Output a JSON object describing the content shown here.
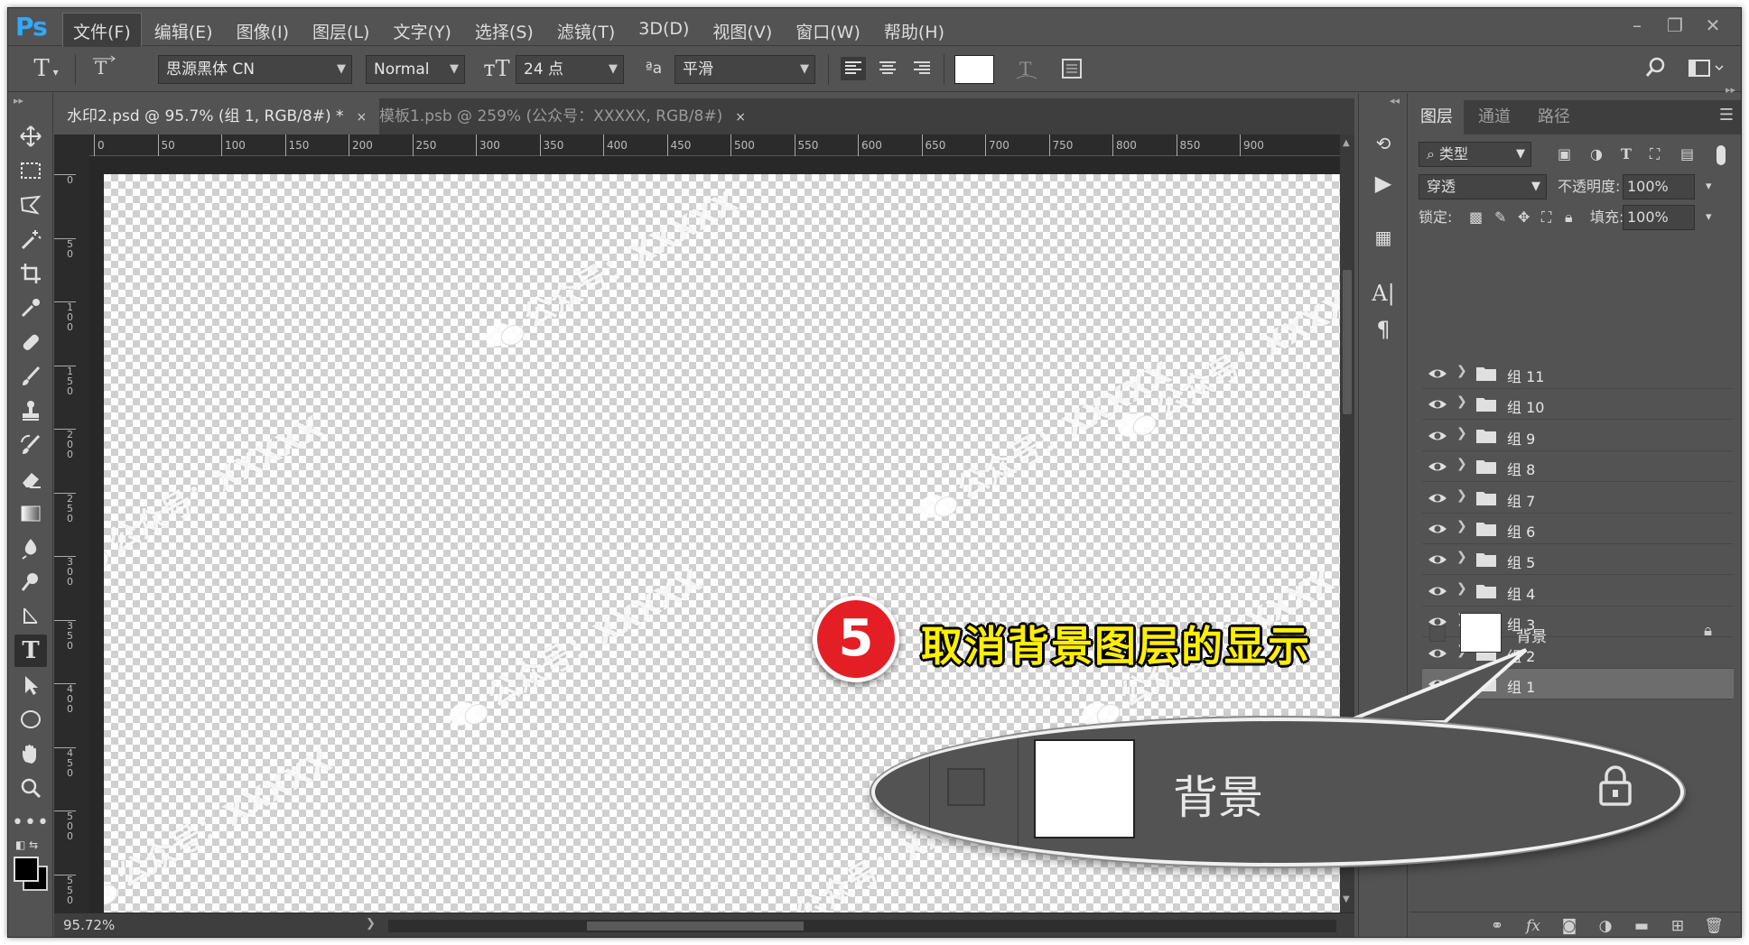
{
  "app": {
    "logo": "Ps"
  },
  "menu": [
    "文件(F)",
    "编辑(E)",
    "图像(I)",
    "图层(L)",
    "文字(Y)",
    "选择(S)",
    "滤镜(T)",
    "3D(D)",
    "视图(V)",
    "窗口(W)",
    "帮助(H)"
  ],
  "window_controls": {
    "minimize": "–",
    "restore": "❐",
    "close": "✕"
  },
  "options": {
    "tool_glyph": "T",
    "font_family": "思源黑体 CN",
    "font_style": "Normal",
    "font_size": "24 点",
    "aa_icon_text": "ªa",
    "antialias": "平滑",
    "color_swatch": "#ffffff"
  },
  "tabs": [
    {
      "label": "水印2.psd @ 95.7% (组 1, RGB/8#) *",
      "close": "×",
      "active": true
    },
    {
      "label": "模板1.psb @ 259% (公众号：XXXXX, RGB/8#)",
      "close": "×",
      "active": false
    }
  ],
  "ruler": {
    "h_ticks": [
      "0",
      "50",
      "100",
      "150",
      "200",
      "250",
      "300",
      "350",
      "400",
      "450",
      "500",
      "550",
      "600",
      "650",
      "700",
      "750",
      "800",
      "850",
      "900"
    ],
    "v_ticks": [
      "0",
      "50",
      "100",
      "150",
      "200",
      "250",
      "300",
      "350",
      "400",
      "450",
      "500",
      "550"
    ]
  },
  "watermark_text": "公众号：XXXXX",
  "status": {
    "zoom": "95.72%"
  },
  "layers_panel": {
    "tabs": [
      "图层",
      "通道",
      "路径"
    ],
    "filter_kind": "类型",
    "blend_mode": "穿透",
    "opacity_label": "不透明度:",
    "opacity": "100%",
    "lock_label": "锁定:",
    "fill_label": "填充:",
    "fill": "100%",
    "groups": [
      "组 11",
      "组 10",
      "组 9",
      "组 8",
      "组 7",
      "组 6",
      "组 5",
      "组 4",
      "组 3",
      "组 2",
      "组 1"
    ],
    "selected_group": "组 1",
    "background_layer": "背景"
  },
  "callout": {
    "step_number": "5",
    "step_text": "取消背景图层的显示",
    "zoom_layer_name": "背景"
  }
}
